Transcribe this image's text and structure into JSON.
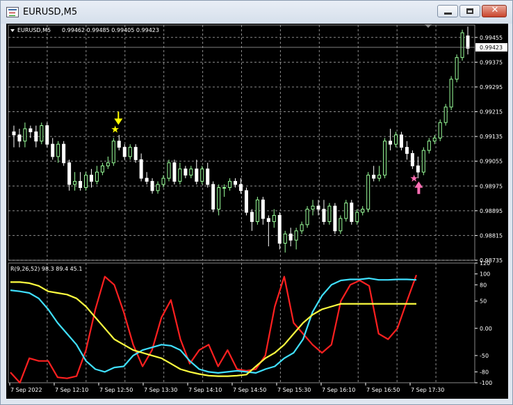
{
  "window": {
    "title": "EURUSD,M5",
    "minimize_label": "",
    "maximize_label": "",
    "close_label": "✕"
  },
  "chart_data": [
    {
      "type": "candlestick",
      "symbol": "EURUSD,M5",
      "ohlc_label": "0.99462 0.99485 0.99405 0.99423",
      "current_price": "0.99423",
      "y_ticks": [
        "0.99455",
        "0.99375",
        "0.99295",
        "0.99215",
        "0.99135",
        "0.99055",
        "0.98975",
        "0.98895",
        "0.98815",
        "0.98735"
      ],
      "ylim": [
        0.98735,
        0.99495
      ],
      "grid": true,
      "up_color": "#9aff9a",
      "down_color": "#ffffff",
      "candles": [
        [
          0.9915,
          0.9917,
          0.991,
          0.9914
        ],
        [
          0.9914,
          0.9916,
          0.991,
          0.9912
        ],
        [
          0.9912,
          0.9918,
          0.991,
          0.9916
        ],
        [
          0.9916,
          0.9917,
          0.9913,
          0.9915
        ],
        [
          0.9915,
          0.9917,
          0.991,
          0.9912
        ],
        [
          0.9912,
          0.9918,
          0.9911,
          0.9917
        ],
        [
          0.9917,
          0.9918,
          0.991,
          0.9911
        ],
        [
          0.9911,
          0.9913,
          0.9906,
          0.9907
        ],
        [
          0.9907,
          0.9912,
          0.9905,
          0.9911
        ],
        [
          0.9911,
          0.9912,
          0.9904,
          0.9905
        ],
        [
          0.9905,
          0.9906,
          0.9896,
          0.9898
        ],
        [
          0.9898,
          0.9902,
          0.9896,
          0.9899
        ],
        [
          0.9899,
          0.9902,
          0.9896,
          0.9897
        ],
        [
          0.9897,
          0.9902,
          0.9896,
          0.9901
        ],
        [
          0.9901,
          0.9903,
          0.9897,
          0.9899
        ],
        [
          0.9899,
          0.9904,
          0.9898,
          0.9902
        ],
        [
          0.9902,
          0.9905,
          0.9901,
          0.9904
        ],
        [
          0.9904,
          0.9907,
          0.9903,
          0.9905
        ],
        [
          0.9905,
          0.9913,
          0.9904,
          0.9912
        ],
        [
          0.9912,
          0.9914,
          0.9909,
          0.991
        ],
        [
          0.991,
          0.9911,
          0.9906,
          0.9907
        ],
        [
          0.9907,
          0.9911,
          0.9906,
          0.991
        ],
        [
          0.991,
          0.9911,
          0.9905,
          0.9906
        ],
        [
          0.9906,
          0.9908,
          0.9899,
          0.99
        ],
        [
          0.99,
          0.9902,
          0.9898,
          0.9899
        ],
        [
          0.9899,
          0.99,
          0.9895,
          0.9896
        ],
        [
          0.9896,
          0.9899,
          0.9895,
          0.9898
        ],
        [
          0.9898,
          0.9901,
          0.9897,
          0.99
        ],
        [
          0.99,
          0.9906,
          0.9899,
          0.9905
        ],
        [
          0.9905,
          0.9906,
          0.9898,
          0.9899
        ],
        [
          0.9899,
          0.9905,
          0.9898,
          0.9903
        ],
        [
          0.9903,
          0.9904,
          0.99,
          0.9901
        ],
        [
          0.9901,
          0.9904,
          0.99,
          0.9903
        ],
        [
          0.9903,
          0.9906,
          0.9898,
          0.9899
        ],
        [
          0.9899,
          0.9904,
          0.9898,
          0.9903
        ],
        [
          0.9903,
          0.9905,
          0.9897,
          0.9898
        ],
        [
          0.9898,
          0.9899,
          0.9889,
          0.989
        ],
        [
          0.989,
          0.9898,
          0.9888,
          0.9897
        ],
        [
          0.9897,
          0.9898,
          0.9894,
          0.9897
        ],
        [
          0.9897,
          0.99,
          0.9896,
          0.9899
        ],
        [
          0.9899,
          0.99,
          0.9897,
          0.9898
        ],
        [
          0.9898,
          0.99,
          0.9895,
          0.9896
        ],
        [
          0.9896,
          0.9897,
          0.9888,
          0.9889
        ],
        [
          0.9889,
          0.989,
          0.9883,
          0.9886
        ],
        [
          0.9886,
          0.9894,
          0.9885,
          0.9893
        ],
        [
          0.9893,
          0.9894,
          0.9885,
          0.9887
        ],
        [
          0.9887,
          0.9888,
          0.9878,
          0.9886
        ],
        [
          0.9886,
          0.989,
          0.9884,
          0.9888
        ],
        [
          0.9888,
          0.9889,
          0.9877,
          0.9879
        ],
        [
          0.9879,
          0.9883,
          0.9876,
          0.9882
        ],
        [
          0.9882,
          0.9884,
          0.9878,
          0.988
        ],
        [
          0.988,
          0.9884,
          0.9877,
          0.9883
        ],
        [
          0.9883,
          0.9886,
          0.9882,
          0.9885
        ],
        [
          0.9885,
          0.9891,
          0.9884,
          0.989
        ],
        [
          0.989,
          0.9893,
          0.9888,
          0.9891
        ],
        [
          0.9891,
          0.9893,
          0.9888,
          0.989
        ],
        [
          0.989,
          0.9893,
          0.9885,
          0.9886
        ],
        [
          0.9886,
          0.9892,
          0.9885,
          0.9891
        ],
        [
          0.9891,
          0.9892,
          0.9882,
          0.9883
        ],
        [
          0.9883,
          0.9888,
          0.9882,
          0.9887
        ],
        [
          0.9887,
          0.9893,
          0.9886,
          0.9892
        ],
        [
          0.9892,
          0.9893,
          0.9885,
          0.9886
        ],
        [
          0.9886,
          0.989,
          0.9885,
          0.9889
        ],
        [
          0.9889,
          0.9891,
          0.9888,
          0.989
        ],
        [
          0.989,
          0.9902,
          0.9889,
          0.9901
        ],
        [
          0.9901,
          0.9904,
          0.9899,
          0.99
        ],
        [
          0.99,
          0.9904,
          0.9899,
          0.9901
        ],
        [
          0.9901,
          0.9913,
          0.99,
          0.9912
        ],
        [
          0.9912,
          0.9916,
          0.9909,
          0.9911
        ],
        [
          0.9911,
          0.9915,
          0.991,
          0.9914
        ],
        [
          0.9914,
          0.9915,
          0.9909,
          0.991
        ],
        [
          0.991,
          0.9912,
          0.9906,
          0.9908
        ],
        [
          0.9908,
          0.9909,
          0.9903,
          0.9904
        ],
        [
          0.9904,
          0.9907,
          0.99,
          0.9902
        ],
        [
          0.9902,
          0.991,
          0.9901,
          0.9909
        ],
        [
          0.9909,
          0.9913,
          0.9908,
          0.9912
        ],
        [
          0.9912,
          0.9914,
          0.9911,
          0.9913
        ],
        [
          0.9913,
          0.9919,
          0.9912,
          0.9918
        ],
        [
          0.9918,
          0.9924,
          0.9917,
          0.9923
        ],
        [
          0.9923,
          0.9933,
          0.9922,
          0.9932
        ],
        [
          0.9932,
          0.994,
          0.9931,
          0.9939
        ],
        [
          0.9939,
          0.9948,
          0.9938,
          0.9947
        ],
        [
          0.9946,
          0.9949,
          0.994,
          0.9942
        ]
      ],
      "x_ticks": [
        "7 Sep 2022",
        "7 Sep 12:10",
        "7 Sep 12:50",
        "7 Sep 13:30",
        "7 Sep 14:10",
        "7 Sep 14:50",
        "7 Sep 15:30",
        "7 Sep 16:10",
        "7 Sep 16:50",
        "7 Sep 17:30"
      ],
      "signals": [
        {
          "type": "sell",
          "candle_index": 18,
          "color": "#ffff00"
        },
        {
          "type": "buy",
          "candle_index": 72,
          "color": "#ff6eb4"
        }
      ]
    },
    {
      "type": "line",
      "label": "R(9,26,52) 98.3 89.4 45.1",
      "y_ticks": [
        "120",
        "100",
        "80",
        "50",
        "0.00",
        "-50",
        "-80",
        "-100"
      ],
      "ylim": [
        -100,
        120
      ],
      "series": [
        {
          "color": "#ff2020",
          "values": [
            -81,
            -100,
            -55,
            -60,
            -60,
            -90,
            -92,
            -88,
            -40,
            35,
            95,
            80,
            30,
            -30,
            -70,
            -40,
            20,
            52,
            -20,
            -65,
            -40,
            -30,
            -70,
            -40,
            -75,
            -78,
            -75,
            -50,
            40,
            95,
            10,
            -10,
            -30,
            -45,
            -30,
            50,
            80,
            88,
            78,
            -10,
            -20,
            0,
            50,
            98
          ]
        },
        {
          "color": "#40e0ff",
          "values": [
            70,
            68,
            65,
            55,
            35,
            10,
            -10,
            -30,
            -60,
            -75,
            -80,
            -72,
            -70,
            -50,
            -40,
            -35,
            -30,
            -32,
            -40,
            -60,
            -75,
            -80,
            -82,
            -80,
            -78,
            -80,
            -82,
            -75,
            -70,
            -55,
            -45,
            -20,
            30,
            60,
            80,
            88,
            90,
            90,
            92,
            89,
            89,
            90,
            90,
            89
          ]
        },
        {
          "color": "#ffff40",
          "values": [
            85,
            85,
            83,
            78,
            68,
            65,
            62,
            55,
            40,
            20,
            0,
            -20,
            -30,
            -40,
            -45,
            -50,
            -55,
            -65,
            -75,
            -80,
            -84,
            -87,
            -88,
            -88,
            -87,
            -85,
            -70,
            -55,
            -45,
            -30,
            -10,
            10,
            25,
            35,
            40,
            45,
            45,
            45,
            45,
            45,
            45,
            45,
            45,
            45
          ]
        }
      ]
    }
  ]
}
